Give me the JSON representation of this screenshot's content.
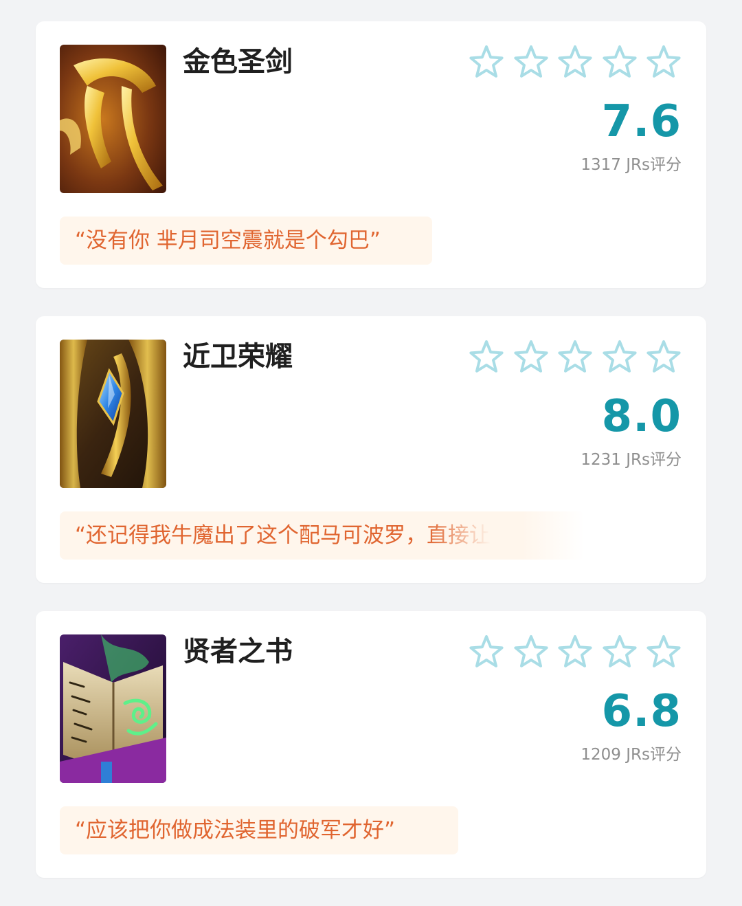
{
  "colors": {
    "background": "#f2f3f5",
    "card": "#ffffff",
    "score": "#1597a8",
    "star_outline": "#a9dde6",
    "quote_text": "#e06530",
    "quote_background": "#fff6ec"
  },
  "items": [
    {
      "name": "金色圣剑",
      "image_icon": "golden-sword-icon",
      "stars_filled": 0,
      "stars_total": 5,
      "score": "7.6",
      "count": "1317 JRs评分",
      "quote": "“没有你 芈月司空震就是个勾巴”"
    },
    {
      "name": "近卫荣耀",
      "image_icon": "guardian-glory-icon",
      "stars_filled": 0,
      "stars_total": 5,
      "score": "8.0",
      "count": "1231 JRs评分",
      "quote": "“还记得我牛魔出了这个配马可波罗，直接让"
    },
    {
      "name": "贤者之书",
      "image_icon": "sage-book-icon",
      "stars_filled": 0,
      "stars_total": 5,
      "score": "6.8",
      "count": "1209 JRs评分",
      "quote": "“应该把你做成法装里的破军才好”"
    }
  ]
}
